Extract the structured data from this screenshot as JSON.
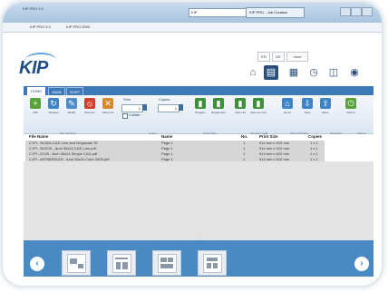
{
  "browser": {
    "tab_left_text": "KIP PRO 9.0",
    "address_text": "KIP",
    "active_tab": "KIP PRO - Job Creation",
    "fav1": "KIP PRO 9.0",
    "fav2": "KIP PRO 9000"
  },
  "app": {
    "logo": "KIP",
    "lang_buttons": [
      "EN",
      "DE",
      "more"
    ],
    "ribbon_tabs": [
      "HOME",
      "MAIN",
      "SORT"
    ],
    "tools": [
      {
        "label": "Add",
        "icon": "+",
        "color": "#59a23a"
      },
      {
        "label": "Replace",
        "icon": "↻",
        "color": "#3e83c6"
      },
      {
        "label": "Modify",
        "icon": "✎",
        "color": "#4f8cc9"
      },
      {
        "label": "Remove",
        "icon": "⦸",
        "color": "#d2402c"
      },
      {
        "label": "Clear List",
        "icon": "✕",
        "color": "#d88a2a"
      }
    ],
    "sets_label": "Sets",
    "copies_label": "Copies",
    "sets_value": "1",
    "copies_value": "1",
    "collate_label": "Collate",
    "right_tools": [
      {
        "label": "Program",
        "icon": "▮",
        "color": "#3f8e3a"
      },
      {
        "label": "Department",
        "icon": "▮",
        "color": "#3f8e3a"
      },
      {
        "label": "Alter List",
        "icon": "▮",
        "color": "#3f8e3a"
      },
      {
        "label": "Remove Job",
        "icon": "▮",
        "color": "#3f8e3a"
      },
      {
        "label": "Home",
        "icon": "⌂",
        "color": "#3e83c6"
      },
      {
        "label": "Save",
        "icon": "⇩",
        "color": "#3e83c6"
      },
      {
        "label": "Store",
        "icon": "⇪",
        "color": "#3e83c6"
      },
      {
        "label": "Submit",
        "icon": "⏻",
        "color": "#59a23a"
      }
    ],
    "group_labels": [
      "File Handling",
      "Copies",
      "Accounting",
      "Operator Code",
      "Stored Printing",
      "Templates",
      "Submit"
    ],
    "table": {
      "headers": [
        "File Name",
        "Name",
        "No.",
        "Print Size",
        "Copies"
      ],
      "rows": [
        [
          "C:\\Pl...\\5042A-CAD Line and Grayscale.Tif",
          "Page 1",
          "1",
          "914 mm x 610 mm",
          "1 x 1"
        ],
        [
          "C:\\Pl...\\5021/5 - Arch 36x24 CAD Line.pdf",
          "Page 1",
          "1",
          "914 mm x 610 mm",
          "1 x 1"
        ],
        [
          "C:\\Pl...\\2125 - Arch 36x24 Simple CAD.pdf",
          "Page 1",
          "1",
          "914 mm x 610 mm",
          "1 x 1"
        ],
        [
          "C:\\Pl...\\e5760/5012/5 - Arch 36x24 Color 2005.pdf",
          "Page 1",
          "1",
          "914 mm x 610 mm",
          "1 x 1"
        ]
      ]
    },
    "nav_prev": "‹",
    "nav_next": "›"
  }
}
